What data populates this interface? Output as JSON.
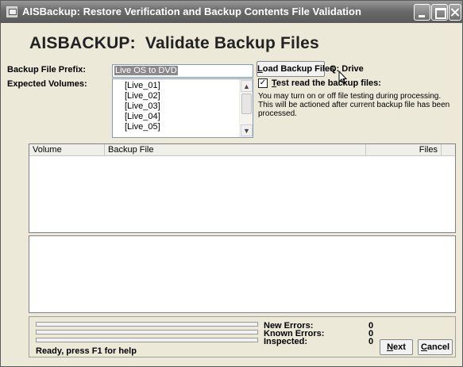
{
  "window": {
    "title": "AISBackup: Restore Verification and Backup Contents File Validation"
  },
  "header": {
    "title": "AISBACKUP:  Validate Backup Files"
  },
  "form": {
    "prefix_label": "Backup File Prefix:",
    "prefix_value": "Live OS to DVD",
    "volumes_label": "Expected Volumes:",
    "volumes": [
      "[Live_01]",
      "[Live_02]",
      "[Live_03]",
      "[Live_04]",
      "[Live_05]"
    ],
    "load_button": "Load Backup Files",
    "drive_label": "Q: Drive",
    "test_read_checked": true,
    "test_read_label": "Test read the backup files:",
    "test_read_help": "You may turn on or off file testing during processing. This will be actioned after current backup file has been processed."
  },
  "table": {
    "columns": [
      "Volume",
      "Backup File",
      "Files"
    ],
    "rows": []
  },
  "status": {
    "new_errors_label": "New Errors:",
    "new_errors_value": "0",
    "known_errors_label": "Known Errors:",
    "known_errors_value": "0",
    "inspected_label": "Inspected:",
    "inspected_value": "0",
    "message": "Ready, press F1 for help",
    "progress": [
      0,
      0,
      0
    ]
  },
  "buttons": {
    "next": "Next",
    "cancel": "Cancel"
  },
  "icons": {
    "app": "app-window-icon",
    "cursor": "mouse-pointer-icon"
  }
}
